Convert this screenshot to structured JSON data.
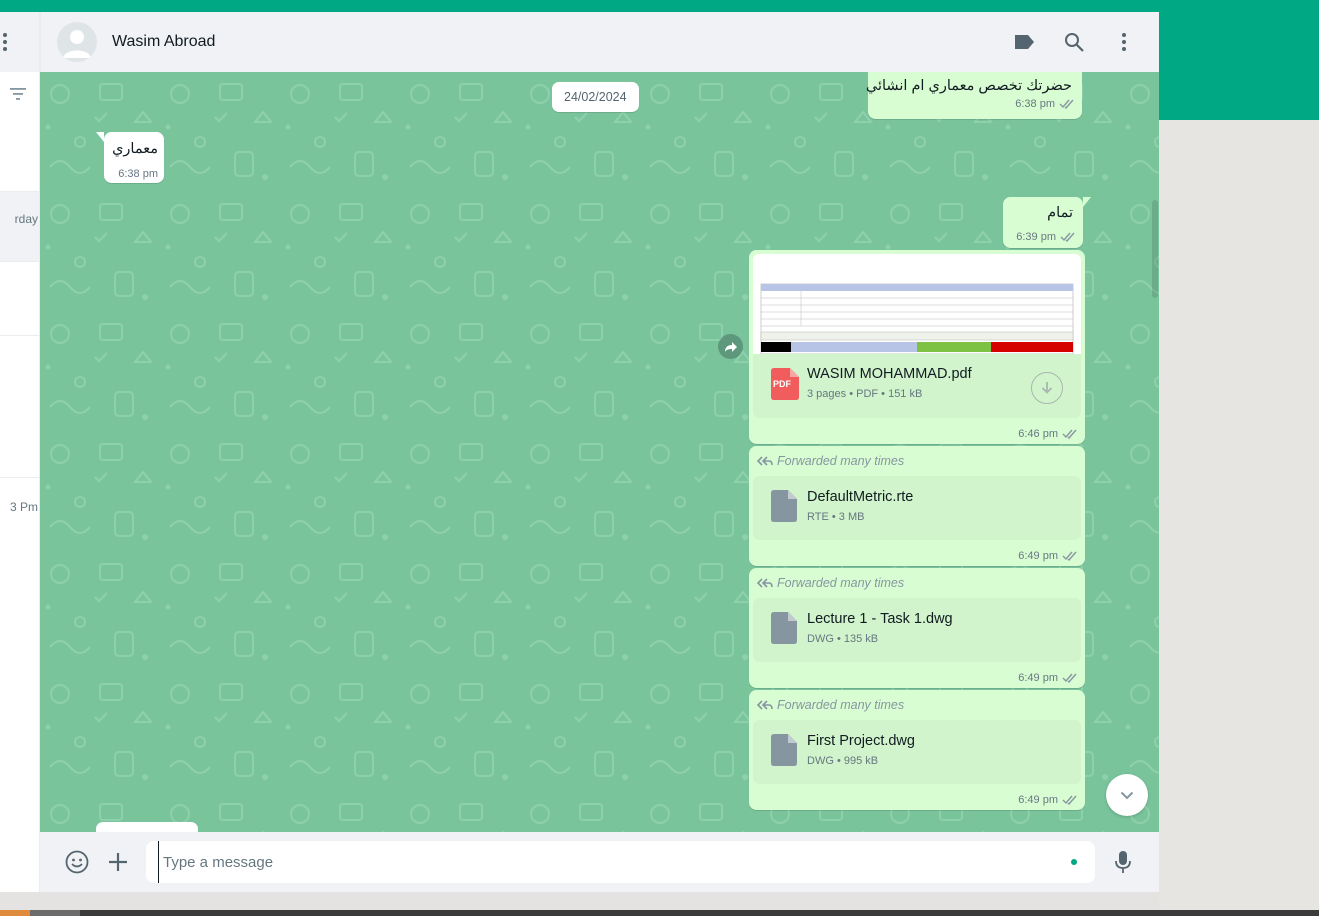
{
  "sidebar": {
    "items": [
      {
        "time_fragment": "rday"
      },
      {
        "time_fragment": "3 Pm"
      }
    ]
  },
  "header": {
    "contact_name": "Wasim Abroad",
    "icons": [
      "label-icon",
      "search-icon",
      "menu-icon"
    ]
  },
  "conversation": {
    "date_divider": "24/02/2024",
    "messages": [
      {
        "direction": "out",
        "text": "حضرتك تخصص معماري ام انشائي",
        "time": "6:38 pm"
      },
      {
        "direction": "in",
        "text": "معماري",
        "time": "6:38 pm"
      },
      {
        "direction": "out",
        "text": "تمام",
        "time": "6:39 pm"
      },
      {
        "direction": "out",
        "type": "pdf",
        "file_name": "WASIM MOHAMMAD.pdf",
        "meta": "3 pages • PDF • 151 kB",
        "icon_label": "PDF",
        "time": "6:46 pm"
      },
      {
        "direction": "out",
        "type": "doc",
        "forwarded": "Forwarded many times",
        "file_name": "DefaultMetric.rte",
        "meta": "RTE • 3 MB",
        "time": "6:49 pm"
      },
      {
        "direction": "out",
        "type": "doc",
        "forwarded": "Forwarded many times",
        "file_name": "Lecture 1 - Task 1.dwg",
        "meta": "DWG • 135 kB",
        "time": "6:49 pm"
      },
      {
        "direction": "out",
        "type": "doc",
        "forwarded": "Forwarded many times",
        "file_name": "First Project.dwg",
        "meta": "DWG • 995 kB",
        "time": "6:49 pm"
      }
    ]
  },
  "composer": {
    "placeholder": "Type a message"
  },
  "colors": {
    "accent": "#00a884",
    "wallpaper": "#7ac49c",
    "outgoing_bubble": "#d9fdd3",
    "incoming_bubble": "#ffffff"
  }
}
